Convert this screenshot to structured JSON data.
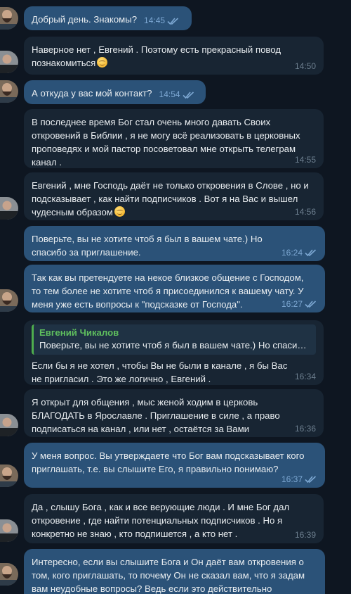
{
  "reply_sender": "Евгений Чикалов",
  "messages": [
    {
      "id": "m1",
      "text": "Добрый день. Знакомы?",
      "time": "14:45",
      "read": true
    },
    {
      "id": "m2",
      "text": "Наверное нет , Евгений . Поэтому есть прекрасный повод познакомиться",
      "emoji": "grin",
      "time": "14:50"
    },
    {
      "id": "m3",
      "text": "А откуда у вас мой контакт?",
      "time": "14:54",
      "read": true
    },
    {
      "id": "m4",
      "text": "В последнее время Бог стал очень много давать Своих откровений в Библии , я не могу всё реализовать в церковных проповедях и мой пастор посоветовал мне открыть телеграм канал .",
      "time": "14:55"
    },
    {
      "id": "m5",
      "text": "Евгений , мне Господь даёт не только откровения в Слове , но и подсказывает , как найти подписчиков . Вот я на Вас и вышел чудесным образом",
      "emoji": "grin",
      "time": "14:56"
    },
    {
      "id": "m6",
      "text": "Поверьте, вы не хотите чтоб я был в вашем чате.) Но спасибо за приглашение.",
      "time": "16:24",
      "read": true
    },
    {
      "id": "m7",
      "text": "Так как вы претендуете на некое близкое общение с Господом, то тем более не хотите чтоб я присоединился к вашему чату. У меня уже есть вопросы к \"подсказке от Господа\".",
      "time": "16:27",
      "read": true
    },
    {
      "id": "m8",
      "reply_text": "Поверьте, вы не хотите чтоб я был в вашем чате.) Но спасиб…",
      "text": "Если бы я не хотел , чтобы Вы не были в канале , я бы Вас не пригласил . Это же логично , Евгений .",
      "time": "16:34"
    },
    {
      "id": "m9",
      "text": "Я открыт для общения , мыс женой ходим в церковь БЛАГОДАТЬ в Ярославле . Приглашение в силе , а право подписаться на канал , или нет , остаётся за Вами",
      "time": "16:36"
    },
    {
      "id": "m10",
      "text": "У меня вопрос. Вы утверждаете что Бог вам подсказывает кого приглашать, т.е. вы слышите Его, я правильно понимаю?",
      "time": "16:37",
      "read": true
    },
    {
      "id": "m11",
      "text": "Да , слышу Бога , как и все верующие люди . И мне Бог дал откровение , где найти потенциальных подписчиков . Но я конкретно не знаю , кто подпишется , а кто нет .",
      "time": "16:39"
    },
    {
      "id": "m12",
      "text": "Интересно, если вы слышите Бога и Он даёт вам откровения о том, кого приглашать, то почему Он не сказал вам, что я задам вам неудобные вопросы? Ведь если это действительно"
    }
  ],
  "avatars": {
    "self": "avatar-bearded-man",
    "other": "avatar-man-dark-shirt"
  },
  "colors": {
    "background": "#0e1621",
    "outgoing_bubble": "#2b5278",
    "incoming_bubble": "#182533",
    "reply_accent": "#4fae4e",
    "read_ticks": "#7da8d3"
  }
}
